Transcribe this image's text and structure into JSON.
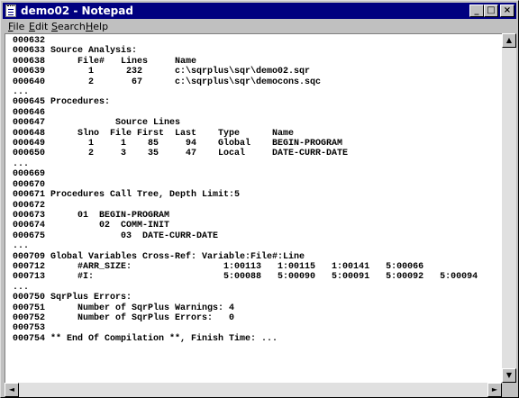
{
  "window": {
    "title": "demo02 - Notepad",
    "controls": {
      "minimize": "_",
      "maximize": "□",
      "close": "×"
    }
  },
  "menu": [
    {
      "label": "File",
      "accel": "F",
      "rest": "ile"
    },
    {
      "label": "Edit",
      "accel": "E",
      "rest": "dit"
    },
    {
      "label": "Search",
      "accel": "S",
      "rest": "earch"
    },
    {
      "label": "Help",
      "accel": "H",
      "rest": "elp"
    }
  ],
  "document": {
    "lines": [
      "000632",
      "000633 Source Analysis:",
      "000638      File#   Lines     Name",
      "000639        1      232      c:\\sqrplus\\sqr\\demo02.sqr",
      "000640        2       67      c:\\sqrplus\\sqr\\democons.sqc",
      "...",
      "000645 Procedures:",
      "000646",
      "000647             Source Lines",
      "000648      Slno  File First  Last    Type      Name",
      "000649        1     1    85     94    Global    BEGIN-PROGRAM",
      "000650        2     3    35     47    Local     DATE-CURR-DATE",
      "...",
      "000669",
      "000670",
      "000671 Procedures Call Tree, Depth Limit:5",
      "000672",
      "000673      01  BEGIN-PROGRAM",
      "000674          02  COMM-INIT",
      "000675              03  DATE-CURR-DATE",
      "...",
      "000709 Global Variables Cross-Ref: Variable:File#:Line",
      "000712      #ARR_SIZE:                 1:00113   1:00115   1:00141   5:00066",
      "000713      #I:                        5:00088   5:00090   5:00091   5:00092   5:00094",
      "...",
      "000750 SqrPlus Errors:",
      "000751      Number of SqrPlus Warnings: 4",
      "000752      Number of SqrPlus Errors:   0",
      "000753",
      "000754 ** End Of Compilation **, Finish Time: ..."
    ]
  },
  "scrollbars": {
    "up": "▲",
    "down": "▼",
    "left": "◄",
    "right": "►"
  }
}
